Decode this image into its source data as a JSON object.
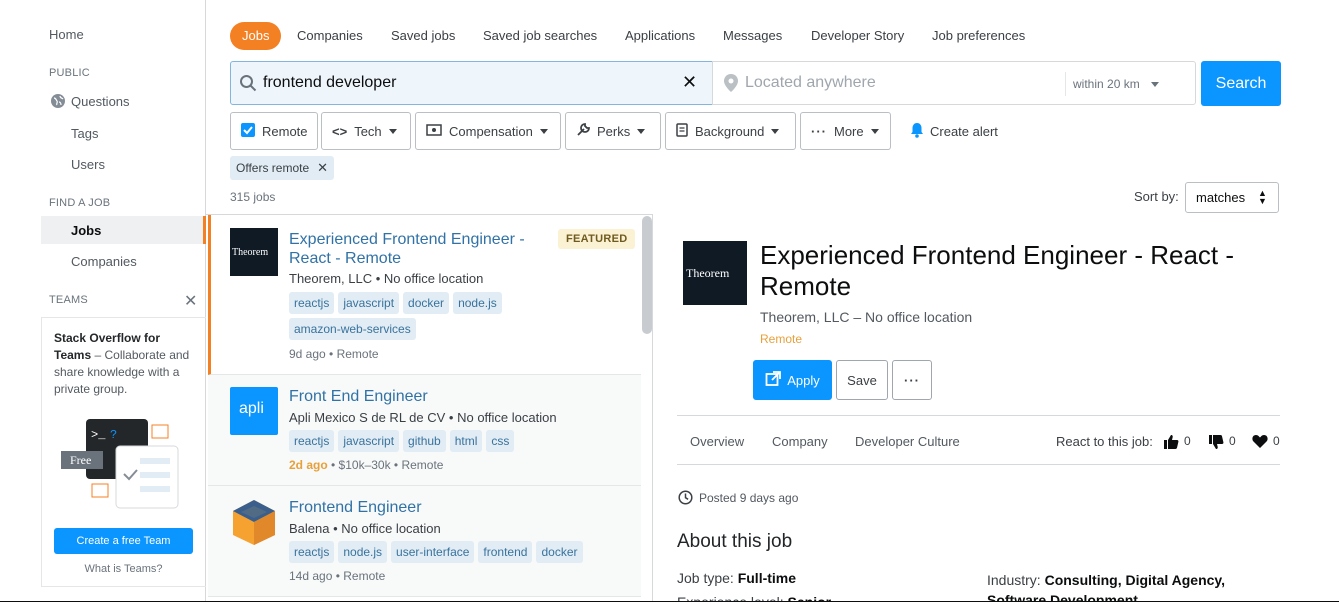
{
  "sidebar": {
    "home": "Home",
    "public_head": "PUBLIC",
    "questions": "Questions",
    "tags": "Tags",
    "users": "Users",
    "findjob_head": "FIND A JOB",
    "jobs": "Jobs",
    "companies": "Companies",
    "teams_head": "TEAMS",
    "teams_promo_title": "Stack Overflow for Teams",
    "teams_promo_body": " – Collaborate and share knowledge with a private group.",
    "free_badge": "Free",
    "create_team_button": "Create a free Team",
    "what_is_teams": "What is Teams?"
  },
  "tabs": [
    "Jobs",
    "Companies",
    "Saved jobs",
    "Saved job searches",
    "Applications",
    "Messages",
    "Developer Story",
    "Job preferences"
  ],
  "search": {
    "query": "frontend developer",
    "location_placeholder": "Located anywhere",
    "distance": "within 20 km",
    "button": "Search"
  },
  "filters": {
    "remote": "Remote",
    "tech": "Tech",
    "compensation": "Compensation",
    "perks": "Perks",
    "background": "Background",
    "more": "More",
    "create_alert": "Create alert",
    "active_chip": "Offers remote"
  },
  "results": {
    "count": "315 jobs",
    "sort_label": "Sort by:",
    "sort_value": "matches"
  },
  "jobs": [
    {
      "title": "Experienced Frontend Engineer - React - Remote",
      "company_line": "Theorem, LLC • No office location",
      "tags": [
        "reactjs",
        "javascript",
        "docker",
        "node.js",
        "amazon-web-services"
      ],
      "posted": "9d ago",
      "meta_rest": " • Remote",
      "featured": "FEATURED",
      "logo_text": "Theorem"
    },
    {
      "title": "Front End Engineer",
      "company_line": "Apli Mexico S de RL de CV • No office location",
      "tags": [
        "reactjs",
        "javascript",
        "github",
        "html",
        "css"
      ],
      "posted": "2d ago",
      "meta_rest": " • $10k–30k • Remote",
      "logo_text": "apli"
    },
    {
      "title": "Frontend Engineer",
      "company_line": "Balena • No office location",
      "tags": [
        "reactjs",
        "node.js",
        "user-interface",
        "frontend",
        "docker"
      ],
      "posted": "14d ago",
      "meta_rest": " • Remote"
    }
  ],
  "detail": {
    "logo_text": "Theorem",
    "title": "Experienced Frontend Engineer - React - Remote",
    "company": "Theorem, LLC – No office location",
    "remote": "Remote",
    "apply": "Apply",
    "save": "Save",
    "tabs": [
      "Overview",
      "Company",
      "Developer Culture"
    ],
    "react_label": "React to this job:",
    "likes": "0",
    "dislikes": "0",
    "hearts": "0",
    "posted": "Posted 9 days ago",
    "about_heading": "About this job",
    "job_type_label": "Job type: ",
    "job_type": "Full-time",
    "industry_label": "Industry: ",
    "industry": "Consulting, Digital Agency, Software Development",
    "experience_label": "Experience level: ",
    "experience": "Senior"
  },
  "colors": {
    "accent": "#f48024",
    "primary": "#0a95ff",
    "link": "#3172a6",
    "tag_bg": "#e1ecf4",
    "tag_fg": "#39739d"
  }
}
